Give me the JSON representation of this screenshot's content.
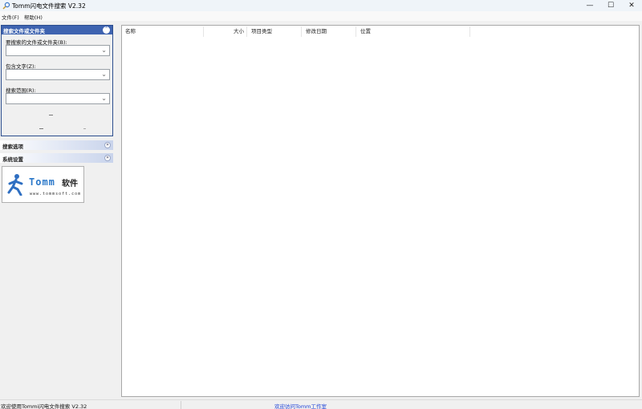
{
  "window": {
    "title": "Tomm闪电文件搜索 V2.32",
    "minimize_glyph": "—",
    "maximize_glyph": "☐",
    "close_glyph": "✕"
  },
  "menu": {
    "items": [
      {
        "label": "文件(F)"
      },
      {
        "label": "帮助(H)"
      }
    ]
  },
  "search_panel": {
    "title": "搜索文件或文件夹",
    "collapse_icon": "chevron-up-circle",
    "fields": [
      {
        "label": "要搜索的文件或文件夹(B):",
        "value": ""
      },
      {
        "label": "包含文字(Z):",
        "value": ""
      },
      {
        "label": "搜索范围(R):",
        "value": ""
      }
    ]
  },
  "sections": [
    {
      "title": "搜索选项",
      "icon": "chevron-double-down"
    },
    {
      "title": "系统设置",
      "icon": "chevron-double-down"
    }
  ],
  "logo": {
    "brand": "Tomm",
    "brand_cn": "软件",
    "url": "www.tommsoft.com",
    "brand_color": "#2b78c9"
  },
  "results_table": {
    "columns": [
      {
        "label": "名称"
      },
      {
        "label": "大小"
      },
      {
        "label": "项目类型"
      },
      {
        "label": "修改日期"
      },
      {
        "label": "位置"
      }
    ],
    "rows": []
  },
  "statusbar": {
    "welcome": "欢迎使用Tommi闪电文件搜索 V2.32",
    "link": "欢迎访问Tomm工作室"
  },
  "colors": {
    "panel_header": "#3e63b0",
    "link": "#1a3fd6"
  }
}
